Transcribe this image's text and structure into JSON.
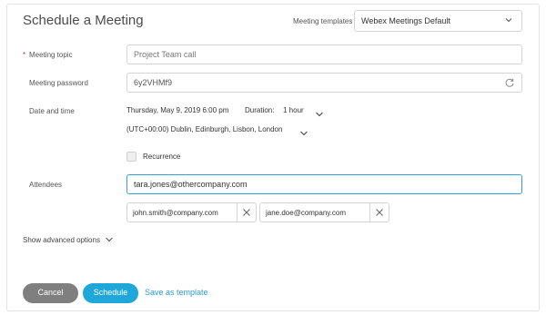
{
  "dialog": {
    "title": "Schedule a Meeting"
  },
  "templates": {
    "label": "Meeting templates",
    "selected": "Webex Meetings Default"
  },
  "topic": {
    "required_mark": "*",
    "label": "Meeting topic",
    "placeholder": "Project Team call"
  },
  "password": {
    "label": "Meeting password",
    "value": "6y2VHMf9"
  },
  "datetime": {
    "label": "Date and time",
    "date": "Thursday, May 9, 2019 6:00 pm",
    "duration_label": "Duration:",
    "duration_value": "1 hour",
    "timezone": "(UTC+00:00) Dublin, Edinburgh, Lisbon, London"
  },
  "recurrence": {
    "label": "Recurrence",
    "checked": false
  },
  "attendees": {
    "label": "Attendees",
    "input_value": "tara.jones@othercompany.com",
    "chips": [
      "john.smith@company.com",
      "jane.doe@company.com"
    ]
  },
  "advanced": {
    "label": "Show advanced options"
  },
  "footer": {
    "cancel_label": "Cancel",
    "schedule_label": "Schedule",
    "save_template_label": "Save as template"
  },
  "colors": {
    "accent": "#1ea7d8",
    "cancel_bg": "#7f7f7f",
    "focus_border": "#32a0d6",
    "required": "#c0392b"
  }
}
